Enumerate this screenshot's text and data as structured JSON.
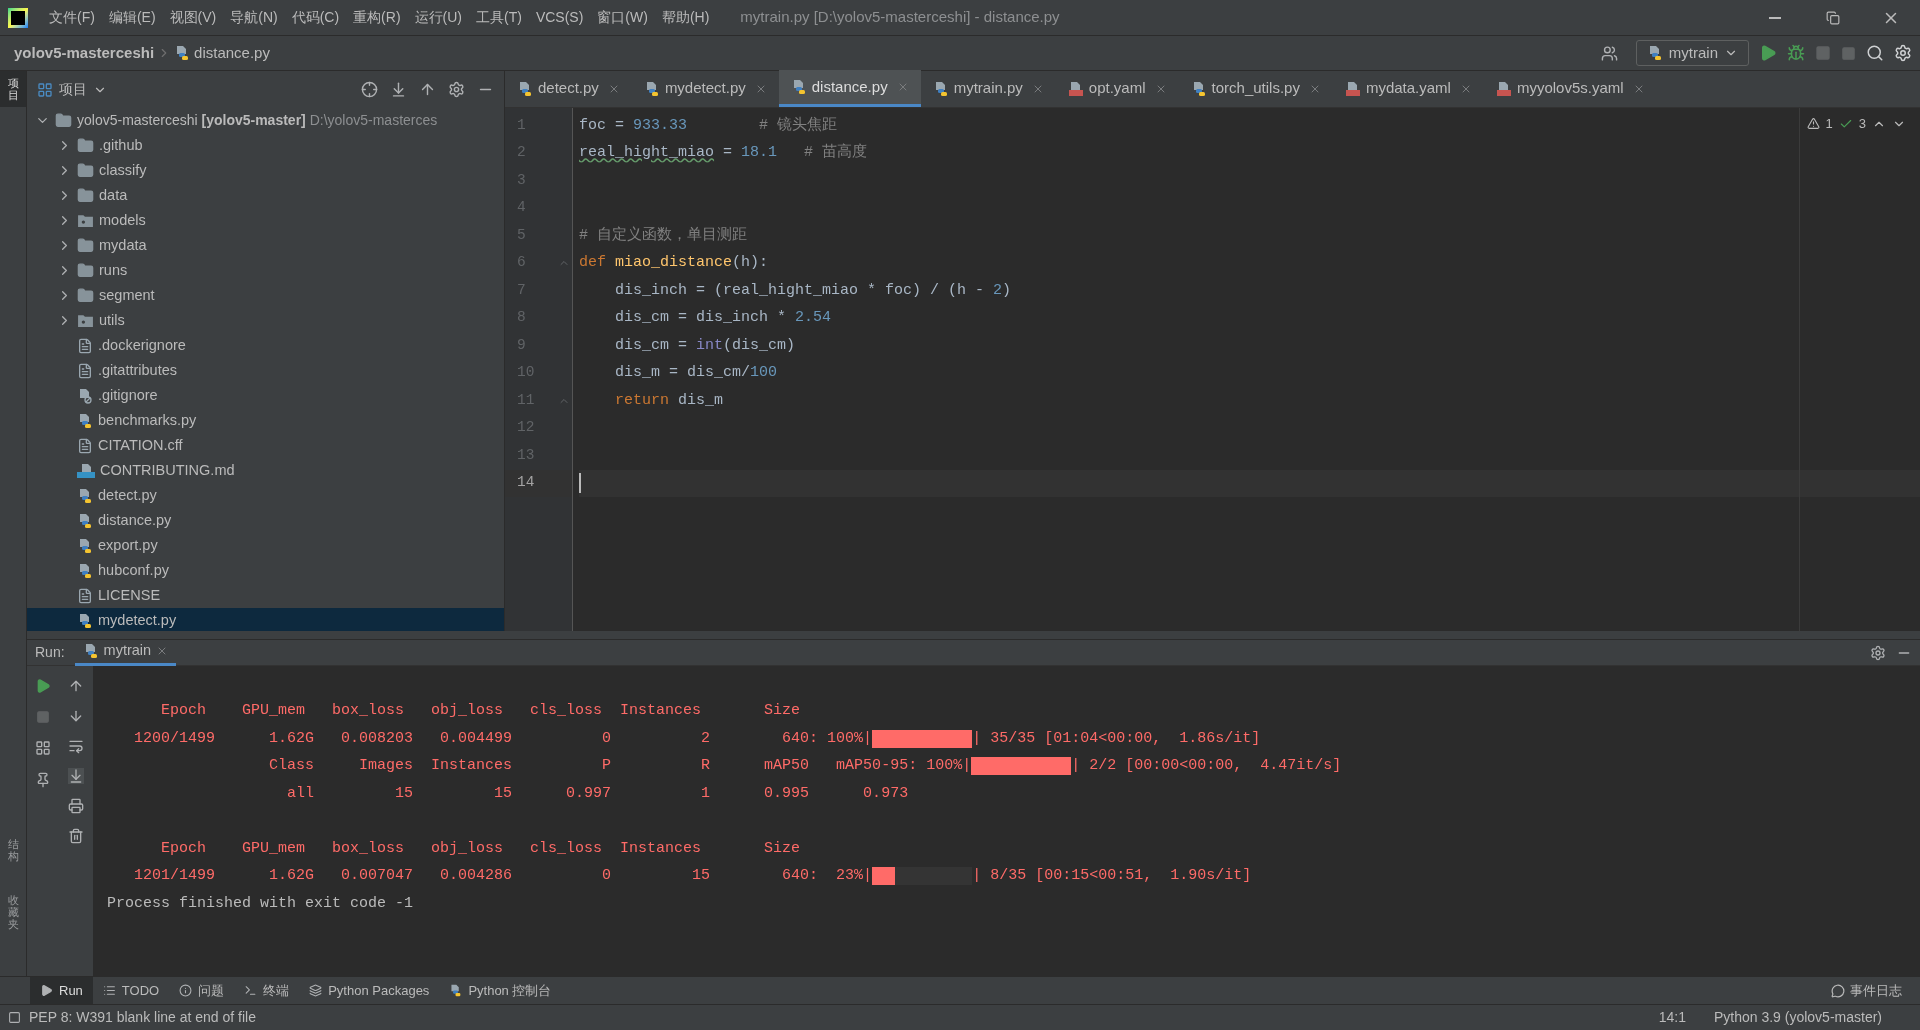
{
  "menu": [
    "文件(F)",
    "编辑(E)",
    "视图(V)",
    "导航(N)",
    "代码(C)",
    "重构(R)",
    "运行(U)",
    "工具(T)",
    "VCS(S)",
    "窗口(W)",
    "帮助(H)"
  ],
  "window": {
    "title": "mytrain.py [D:\\yolov5-masterceshi] - distance.py"
  },
  "breadcrumb": [
    "yolov5-masterceshi",
    "distance.py"
  ],
  "run_config": "mytrain",
  "side_left": [
    {
      "label": "项目",
      "selected": true
    },
    {
      "label": "结构",
      "selected": false
    },
    {
      "label": "收藏夹",
      "selected": false
    }
  ],
  "project": {
    "title": "项目",
    "root": {
      "name": "yolov5-masterceshi",
      "module": "[yolov5-master]",
      "path": "D:\\yolov5-masterces",
      "expanded": true,
      "children": [
        {
          "name": ".github",
          "kind": "folder",
          "expanded": false,
          "selected": false
        },
        {
          "name": "classify",
          "kind": "folder",
          "expanded": false,
          "selected": false
        },
        {
          "name": "data",
          "kind": "folder",
          "expanded": false,
          "selected": false
        },
        {
          "name": "models",
          "kind": "package",
          "expanded": false,
          "selected": false
        },
        {
          "name": "mydata",
          "kind": "folder",
          "expanded": false,
          "selected": false
        },
        {
          "name": "runs",
          "kind": "folder",
          "expanded": false,
          "selected": false
        },
        {
          "name": "segment",
          "kind": "folder",
          "expanded": false,
          "selected": false
        },
        {
          "name": "utils",
          "kind": "package",
          "expanded": false,
          "selected": false
        },
        {
          "name": ".dockerignore",
          "kind": "text",
          "selected": false
        },
        {
          "name": ".gitattributes",
          "kind": "text",
          "selected": false
        },
        {
          "name": ".gitignore",
          "kind": "ignore",
          "selected": false
        },
        {
          "name": "benchmarks.py",
          "kind": "python",
          "selected": false
        },
        {
          "name": "CITATION.cff",
          "kind": "text",
          "selected": false
        },
        {
          "name": "CONTRIBUTING.md",
          "kind": "markdown",
          "selected": false
        },
        {
          "name": "detect.py",
          "kind": "python",
          "selected": false
        },
        {
          "name": "distance.py",
          "kind": "python",
          "selected": false
        },
        {
          "name": "export.py",
          "kind": "python",
          "selected": false
        },
        {
          "name": "hubconf.py",
          "kind": "python",
          "selected": false
        },
        {
          "name": "LICENSE",
          "kind": "text",
          "selected": false
        },
        {
          "name": "mydetect.py",
          "kind": "python",
          "selected": true
        }
      ]
    }
  },
  "tabs": [
    {
      "label": "detect.py",
      "kind": "python",
      "selected": false
    },
    {
      "label": "mydetect.py",
      "kind": "python",
      "selected": false
    },
    {
      "label": "distance.py",
      "kind": "python",
      "selected": true
    },
    {
      "label": "mytrain.py",
      "kind": "python",
      "selected": false
    },
    {
      "label": "opt.yaml",
      "kind": "yaml",
      "selected": false
    },
    {
      "label": "torch_utils.py",
      "kind": "python",
      "selected": false
    },
    {
      "label": "mydata.yaml",
      "kind": "yaml",
      "selected": false
    },
    {
      "label": "myyolov5s.yaml",
      "kind": "yaml",
      "selected": false
    }
  ],
  "inspections": {
    "warnings": "1",
    "ok": "3"
  },
  "code": [
    {
      "number": "1",
      "current": false,
      "tokens": [
        {
          "t": "foc = ",
          "kind": "plain"
        },
        {
          "t": "933.33",
          "kind": "number"
        },
        {
          "t": "        # 镜头焦距",
          "kind": "comment"
        }
      ]
    },
    {
      "number": "2",
      "current": false,
      "tokens": [
        {
          "t": "real_hight_miao",
          "kind": "typo"
        },
        {
          "t": " = ",
          "kind": "plain"
        },
        {
          "t": "18.1",
          "kind": "number"
        },
        {
          "t": "   # 苗高度",
          "kind": "comment"
        }
      ]
    },
    {
      "number": "3",
      "current": false
    },
    {
      "number": "4",
      "current": false
    },
    {
      "number": "5",
      "current": false,
      "tokens": [
        {
          "t": "# 自定义函数，单目测距",
          "kind": "comment"
        }
      ]
    },
    {
      "number": "6",
      "current": false,
      "fold": true,
      "tokens": [
        {
          "t": "def ",
          "kind": "keyword"
        },
        {
          "t": "miao_distance",
          "kind": "function"
        },
        {
          "t": "(h):",
          "kind": "plain"
        }
      ]
    },
    {
      "number": "7",
      "current": false,
      "tokens": [
        {
          "t": "    dis_inch = (real_hight_miao * foc) / (h - ",
          "kind": "plain"
        },
        {
          "t": "2",
          "kind": "number"
        },
        {
          "t": ")",
          "kind": "plain"
        }
      ]
    },
    {
      "number": "8",
      "current": false,
      "tokens": [
        {
          "t": "    dis_cm = dis_inch * ",
          "kind": "plain"
        },
        {
          "t": "2.54",
          "kind": "number"
        }
      ]
    },
    {
      "number": "9",
      "current": false,
      "tokens": [
        {
          "t": "    dis_cm = ",
          "kind": "plain"
        },
        {
          "t": "int",
          "kind": "builtin"
        },
        {
          "t": "(dis_cm)",
          "kind": "plain"
        }
      ]
    },
    {
      "number": "10",
      "current": false,
      "tokens": [
        {
          "t": "    dis_m = dis_cm/",
          "kind": "plain"
        },
        {
          "t": "100",
          "kind": "number"
        }
      ]
    },
    {
      "number": "11",
      "current": false,
      "fold": true,
      "tokens": [
        {
          "t": "    return",
          "kind": "keyword"
        },
        {
          "t": " dis_m",
          "kind": "plain"
        }
      ]
    },
    {
      "number": "12",
      "current": false
    },
    {
      "number": "13",
      "current": false
    },
    {
      "number": "14",
      "current": true
    }
  ],
  "run": {
    "label": "Run:",
    "tab": "mytrain",
    "lines": [
      {
        "kind": "blank"
      },
      {
        "kind": "error",
        "text": "      Epoch    GPU_mem   box_loss   obj_loss   cls_loss  Instances       Size"
      },
      {
        "kind": "progress",
        "before": "   1200/1499      1.62G   0.008203   0.004499          0          2        640: 100%|",
        "level": 1,
        "after": "| 35/35 [01:04<00:00,  1.86s/it]"
      },
      {
        "kind": "progress",
        "before": "                  Class     Images  Instances          P          R      mAP50   mAP50-95: 100%|",
        "level": 1,
        "after": "| 2/2 [00:00<00:00,  4.47it/s]"
      },
      {
        "kind": "error",
        "text": "                    all         15         15      0.997          1      0.995      0.973"
      },
      {
        "kind": "blank"
      },
      {
        "kind": "error",
        "text": "      Epoch    GPU_mem   box_loss   obj_loss   cls_loss  Instances       Size"
      },
      {
        "kind": "progress",
        "before": "   1201/1499      1.62G   0.007047   0.004286          0         15        640:  23%|",
        "level": 0.23,
        "after": "| 8/35 [00:15<00:51,  1.90s/it]"
      },
      {
        "kind": "normal",
        "text": "Process finished with exit code -1"
      }
    ]
  },
  "tool_tabs": [
    {
      "label": "Run",
      "kind": "run",
      "selected": true
    },
    {
      "label": "TODO",
      "kind": "todo",
      "selected": false
    },
    {
      "label": "问题",
      "kind": "problems",
      "selected": false
    },
    {
      "label": "终端",
      "kind": "terminal",
      "selected": false
    },
    {
      "label": "Python Packages",
      "kind": "packages",
      "selected": false
    },
    {
      "label": "Python 控制台",
      "kind": "console",
      "selected": false
    }
  ],
  "event_log": "事件日志",
  "status": {
    "message": "PEP 8: W391 blank line at end of file",
    "position": "14:1",
    "interpreter": "Python 3.9 (yolov5-master)"
  }
}
